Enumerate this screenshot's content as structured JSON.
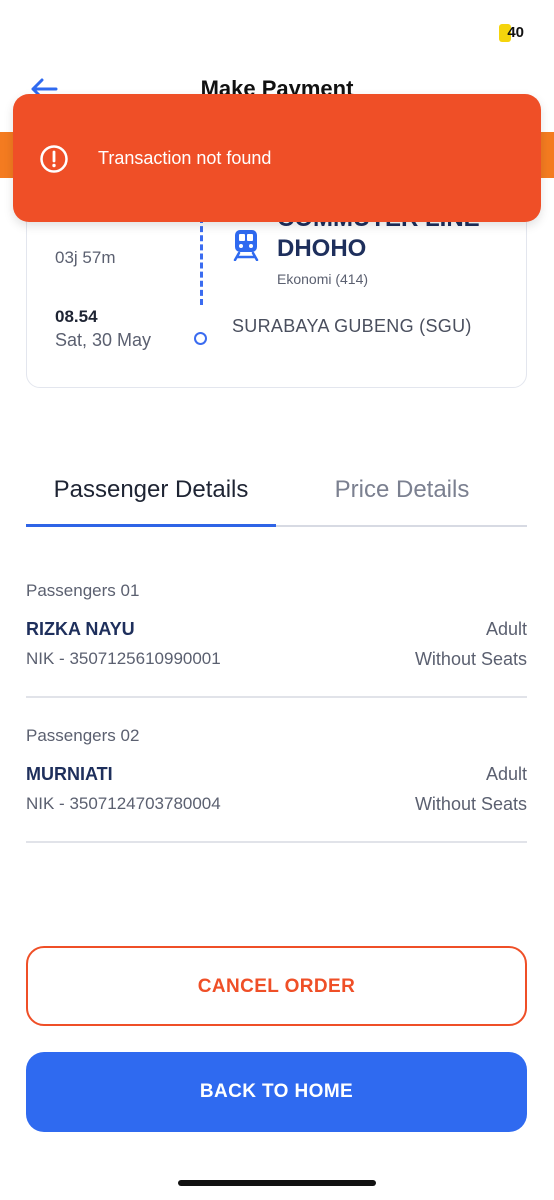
{
  "status_bar": {
    "battery": "40"
  },
  "header": {
    "title": "Make Payment"
  },
  "toast": {
    "message": "Transaction not found",
    "icon": "alert-circle-icon",
    "color": "#ef4f27"
  },
  "trip": {
    "duration": "03j 57m",
    "arrival_time": "08.54",
    "arrival_date": "Sat, 30 May",
    "train_name": "COMMUTER LINE DHOHO",
    "train_class": "Ekonomi (414)",
    "destination": "SURABAYA GUBENG (SGU)"
  },
  "tabs": [
    {
      "label": "Passenger Details",
      "active": true
    },
    {
      "label": "Price Details",
      "active": false
    }
  ],
  "passengers": [
    {
      "heading": "Passengers 01",
      "name": "RIZKA NAYU",
      "type": "Adult",
      "nik": "NIK - 3507125610990001",
      "seat": "Without Seats"
    },
    {
      "heading": "Passengers 02",
      "name": "MURNIATI",
      "type": "Adult",
      "nik": "NIK - 3507124703780004",
      "seat": "Without Seats"
    }
  ],
  "actions": {
    "cancel_label": "CANCEL ORDER",
    "home_label": "BACK TO HOME"
  },
  "colors": {
    "accent_blue": "#2f6af0",
    "accent_orange": "#ef4f27",
    "band_orange": "#f47b20"
  }
}
